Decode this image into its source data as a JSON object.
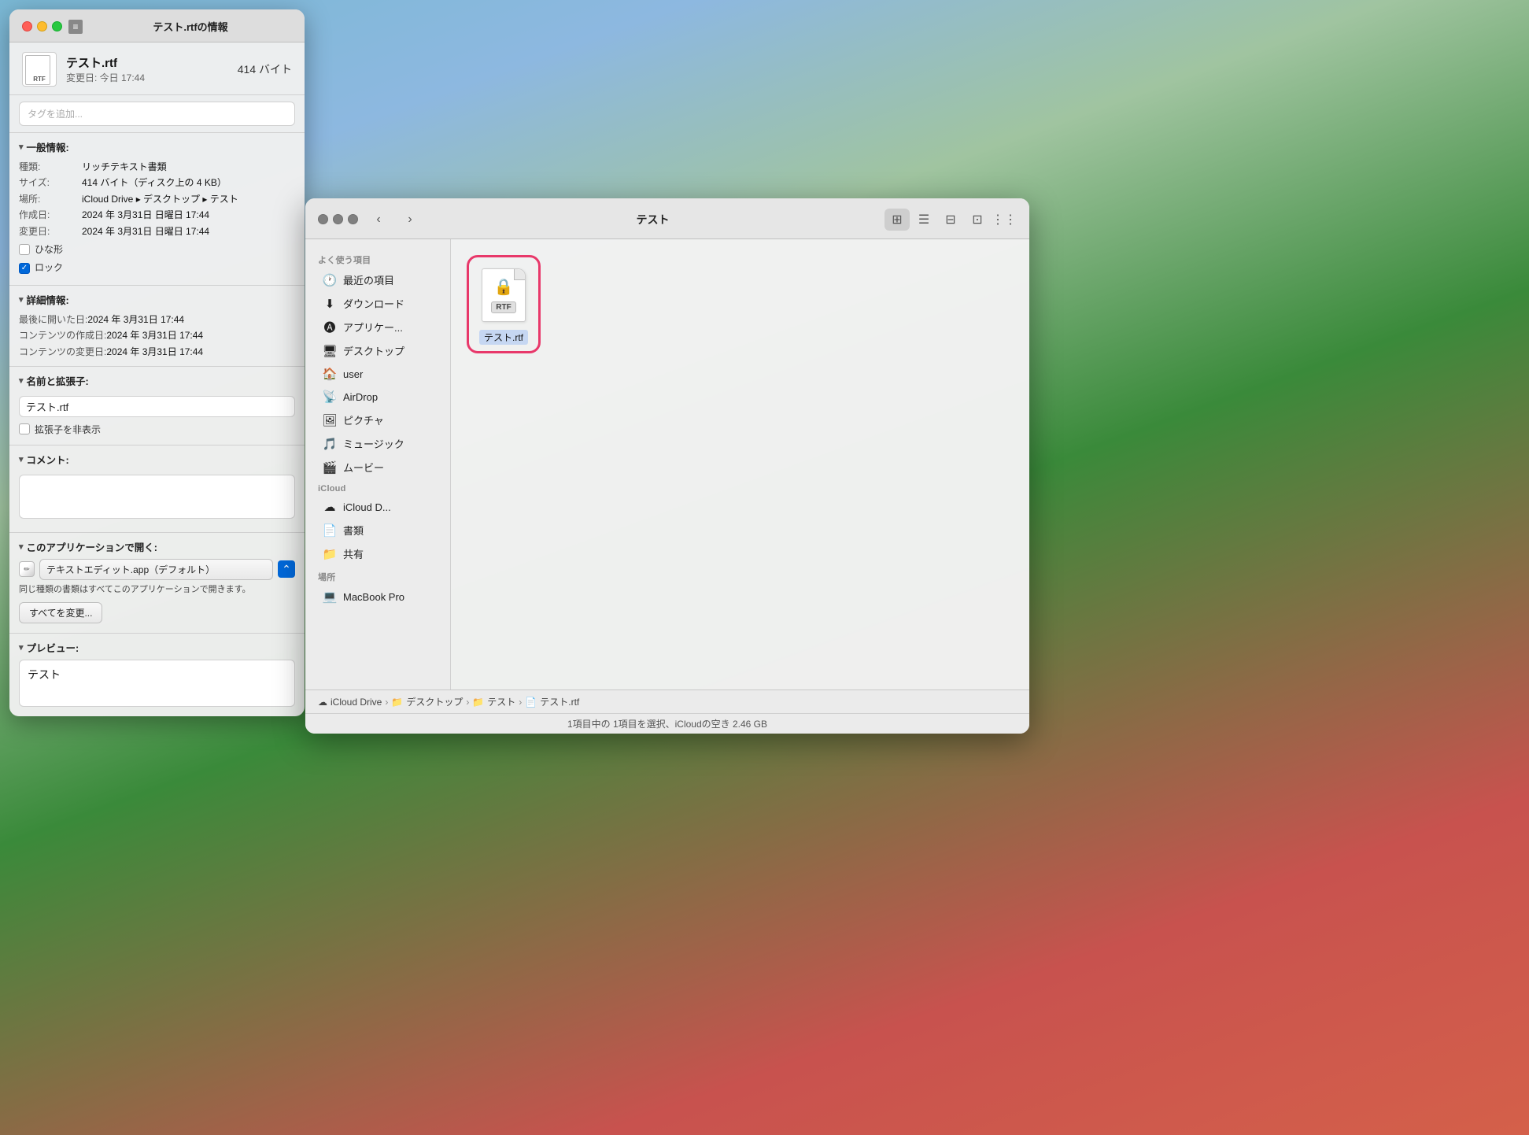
{
  "desktop": {
    "bg_gradient": "macOS Sonoma"
  },
  "info_panel": {
    "title": "テスト.rtfの情報",
    "file_name": "テスト.rtf",
    "file_size": "414 バイト",
    "modified": "変更日: 今日 17:44",
    "tag_placeholder": "タグを追加...",
    "sections": {
      "general": {
        "header": "一般情報:",
        "kind_label": "種類: ",
        "kind_value": "リッチテキスト書類",
        "size_label": "サイズ: ",
        "size_value": "414 バイト（ディスク上の 4 KB）",
        "location_label": "場所: ",
        "location_value": "iCloud Drive ▸ デスクトップ ▸ テスト",
        "created_label": "作成日: ",
        "created_value": "2024 年 3月31日 日曜日 17:44",
        "modified_label": "変更日: ",
        "modified_value": "2024 年 3月31日 日曜日 17:44",
        "hina_label": "ひな形",
        "lock_label": "ロック"
      },
      "detail": {
        "header": "詳細情報:",
        "last_opened_label": "最後に開いた日: ",
        "last_opened_value": "2024 年 3月31日 17:44",
        "content_created_label": "コンテンツの作成日: ",
        "content_created_value": "2024 年 3月31日 17:44",
        "content_modified_label": "コンテンツの変更日: ",
        "content_modified_value": "2024 年 3月31日 17:44"
      },
      "name": {
        "header": "名前と拡張子:",
        "filename_value": "テスト.rtf",
        "hide_ext_label": "拡張子を非表示"
      },
      "comment": {
        "header": "コメント:"
      },
      "open_with": {
        "header": "このアプリケーションで開く:",
        "app_name": "テキストエディット.app（デフォルト）",
        "description": "同じ種類の書類はすべてこのアプリケーションで開きます。",
        "change_all_btn": "すべてを変更..."
      },
      "preview": {
        "header": "プレビュー:",
        "content": "テスト"
      }
    }
  },
  "finder": {
    "title": "テスト",
    "sidebar": {
      "favorites_label": "よく使う項目",
      "items": [
        {
          "label": "最近の項目",
          "icon": "🕐"
        },
        {
          "label": "ダウンロード",
          "icon": "⬇"
        },
        {
          "label": "アプリケー...",
          "icon": "🅐"
        },
        {
          "label": "デスクトップ",
          "icon": "🖥"
        },
        {
          "label": "user",
          "icon": "🏠"
        },
        {
          "label": "AirDrop",
          "icon": "📡"
        },
        {
          "label": "ピクチャ",
          "icon": "🖼"
        },
        {
          "label": "ミュージック",
          "icon": "🎵"
        },
        {
          "label": "ムービー",
          "icon": "🎬"
        }
      ],
      "icloud_label": "iCloud",
      "icloud_items": [
        {
          "label": "iCloud D...",
          "icon": "☁"
        },
        {
          "label": "書類",
          "icon": "📄"
        },
        {
          "label": "共有",
          "icon": "📁"
        }
      ],
      "locations_label": "場所",
      "location_items": [
        {
          "label": "MacBook Pro",
          "icon": "💻"
        }
      ]
    },
    "file": {
      "name": "テスト.rtf",
      "badge": "RTF"
    },
    "breadcrumb": {
      "items": [
        {
          "label": "iCloud Drive",
          "icon": "☁"
        },
        {
          "label": "デスクトップ",
          "icon": "📁"
        },
        {
          "label": "テスト",
          "icon": "📁"
        },
        {
          "label": "テスト.rtf",
          "icon": "📄"
        }
      ]
    },
    "status": "1項目中の 1項目を選択、iCloudの空き 2.46 GB"
  }
}
